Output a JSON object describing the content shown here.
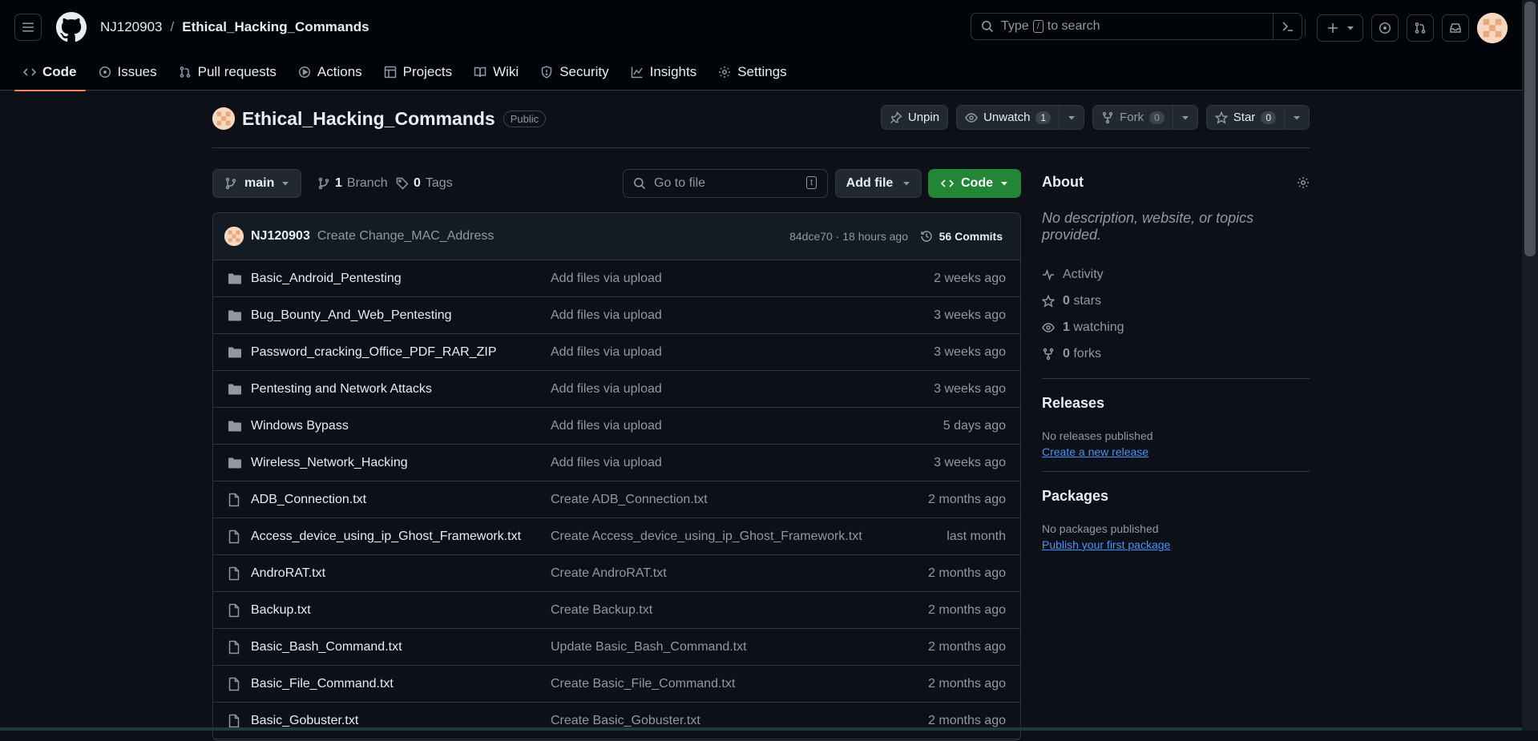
{
  "header": {
    "owner": "NJ120903",
    "separator": "/",
    "repo": "Ethical_Hacking_Commands",
    "search_prefix": "Type",
    "search_key": "/",
    "search_suffix": "to search"
  },
  "tabs": [
    {
      "label": "Code",
      "icon": "code-icon"
    },
    {
      "label": "Issues",
      "icon": "issue-icon"
    },
    {
      "label": "Pull requests",
      "icon": "pull-request-icon"
    },
    {
      "label": "Actions",
      "icon": "play-icon"
    },
    {
      "label": "Projects",
      "icon": "table-icon"
    },
    {
      "label": "Wiki",
      "icon": "book-icon"
    },
    {
      "label": "Security",
      "icon": "shield-icon"
    },
    {
      "label": "Insights",
      "icon": "graph-icon"
    },
    {
      "label": "Settings",
      "icon": "gear-icon"
    }
  ],
  "repo": {
    "name": "Ethical_Hacking_Commands",
    "visibility": "Public",
    "unpin_label": "Unpin",
    "unwatch_label": "Unwatch",
    "watch_count": "1",
    "fork_label": "Fork",
    "fork_count": "0",
    "star_label": "Star",
    "star_count": "0"
  },
  "filenav": {
    "branch": "main",
    "branch_count": "1",
    "branch_label": "Branch",
    "tag_count": "0",
    "tag_label": "Tags",
    "goto_placeholder": "Go to file",
    "goto_key": "t",
    "add_file": "Add file",
    "code": "Code"
  },
  "commit": {
    "author": "NJ120903",
    "message": "Create Change_MAC_Address",
    "hash_time": "84dce70 · 18 hours ago",
    "count_label": "56 Commits"
  },
  "files": [
    {
      "type": "folder",
      "name": "Basic_Android_Pentesting",
      "commit": "Add files via upload",
      "time": "2 weeks ago"
    },
    {
      "type": "folder",
      "name": "Bug_Bounty_And_Web_Pentesting",
      "commit": "Add files via upload",
      "time": "3 weeks ago"
    },
    {
      "type": "folder",
      "name": "Password_cracking_Office_PDF_RAR_ZIP",
      "commit": "Add files via upload",
      "time": "3 weeks ago"
    },
    {
      "type": "folder",
      "name": "Pentesting and Network Attacks",
      "commit": "Add files via upload",
      "time": "3 weeks ago"
    },
    {
      "type": "folder",
      "name": "Windows Bypass",
      "commit": "Add files via upload",
      "time": "5 days ago"
    },
    {
      "type": "folder",
      "name": "Wireless_Network_Hacking",
      "commit": "Add files via upload",
      "time": "3 weeks ago"
    },
    {
      "type": "file",
      "name": "ADB_Connection.txt",
      "commit": "Create ADB_Connection.txt",
      "time": "2 months ago"
    },
    {
      "type": "file",
      "name": "Access_device_using_ip_Ghost_Framework.txt",
      "commit": "Create Access_device_using_ip_Ghost_Framework.txt",
      "time": "last month"
    },
    {
      "type": "file",
      "name": "AndroRAT.txt",
      "commit": "Create AndroRAT.txt",
      "time": "2 months ago"
    },
    {
      "type": "file",
      "name": "Backup.txt",
      "commit": "Create Backup.txt",
      "time": "2 months ago"
    },
    {
      "type": "file",
      "name": "Basic_Bash_Command.txt",
      "commit": "Update Basic_Bash_Command.txt",
      "time": "2 months ago"
    },
    {
      "type": "file",
      "name": "Basic_File_Command.txt",
      "commit": "Create Basic_File_Command.txt",
      "time": "2 months ago"
    },
    {
      "type": "file",
      "name": "Basic_Gobuster.txt",
      "commit": "Create Basic_Gobuster.txt",
      "time": "2 months ago"
    }
  ],
  "about": {
    "title": "About",
    "description": "No description, website, or topics provided.",
    "activity": "Activity",
    "stars_count": "0",
    "stars_label": "stars",
    "watching_count": "1",
    "watching_label": "watching",
    "forks_count": "0",
    "forks_label": "forks"
  },
  "releases": {
    "title": "Releases",
    "empty": "No releases published",
    "link": "Create a new release"
  },
  "packages": {
    "title": "Packages",
    "empty": "No packages published",
    "link": "Publish your first package"
  },
  "colors": {
    "background": "#0d1117",
    "header": "#010409",
    "accent_tab": "#f78166",
    "primary_button": "#238636",
    "link": "#4493f8"
  }
}
